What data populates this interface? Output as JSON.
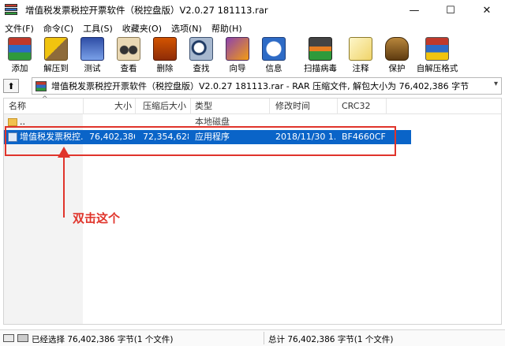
{
  "window": {
    "title": "增值税发票税控开票软件（税控盘版）V2.0.27 181113.rar",
    "minimize": "—",
    "maximize": "☐",
    "close": "✕"
  },
  "menu": [
    "文件(F)",
    "命令(C)",
    "工具(S)",
    "收藏夹(O)",
    "选项(N)",
    "帮助(H)"
  ],
  "toolbar": [
    {
      "label": "添加",
      "icon": "add-icon"
    },
    {
      "label": "解压到",
      "icon": "extract-icon"
    },
    {
      "label": "测试",
      "icon": "test-icon"
    },
    {
      "label": "查看",
      "icon": "view-icon"
    },
    {
      "label": "删除",
      "icon": "delete-icon"
    },
    {
      "label": "查找",
      "icon": "find-icon"
    },
    {
      "label": "向导",
      "icon": "wizard-icon"
    },
    {
      "label": "信息",
      "icon": "info-icon"
    },
    {
      "label": "扫描病毒",
      "icon": "scan-icon"
    },
    {
      "label": "注释",
      "icon": "comment-icon"
    },
    {
      "label": "保护",
      "icon": "protect-icon"
    },
    {
      "label": "自解压格式",
      "icon": "sfx-icon"
    }
  ],
  "address": {
    "path": "增值税发票税控开票软件（税控盘版）V2.0.27 181113.rar - RAR 压缩文件, 解包大小为 76,402,386 字节"
  },
  "columns": {
    "name": "名称",
    "size": "大小",
    "packed": "压缩后大小",
    "type": "类型",
    "modified": "修改时间",
    "crc": "CRC32"
  },
  "rows": [
    {
      "name": "..",
      "size": "",
      "packed": "",
      "type": "本地磁盘",
      "modified": "",
      "crc": ""
    },
    {
      "name": "增值税发票税控...",
      "size": "76,402,386",
      "packed": "72,354,628",
      "type": "应用程序",
      "modified": "2018/11/30 1...",
      "crc": "BF4660CF"
    }
  ],
  "annotation": {
    "text": "双击这个",
    "color": "#e0342b"
  },
  "status": {
    "left": "已经选择 76,402,386 字节(1 个文件)",
    "right": "总计 76,402,386 字节(1 个文件)"
  },
  "colors": {
    "selection": "#0a64c8"
  }
}
